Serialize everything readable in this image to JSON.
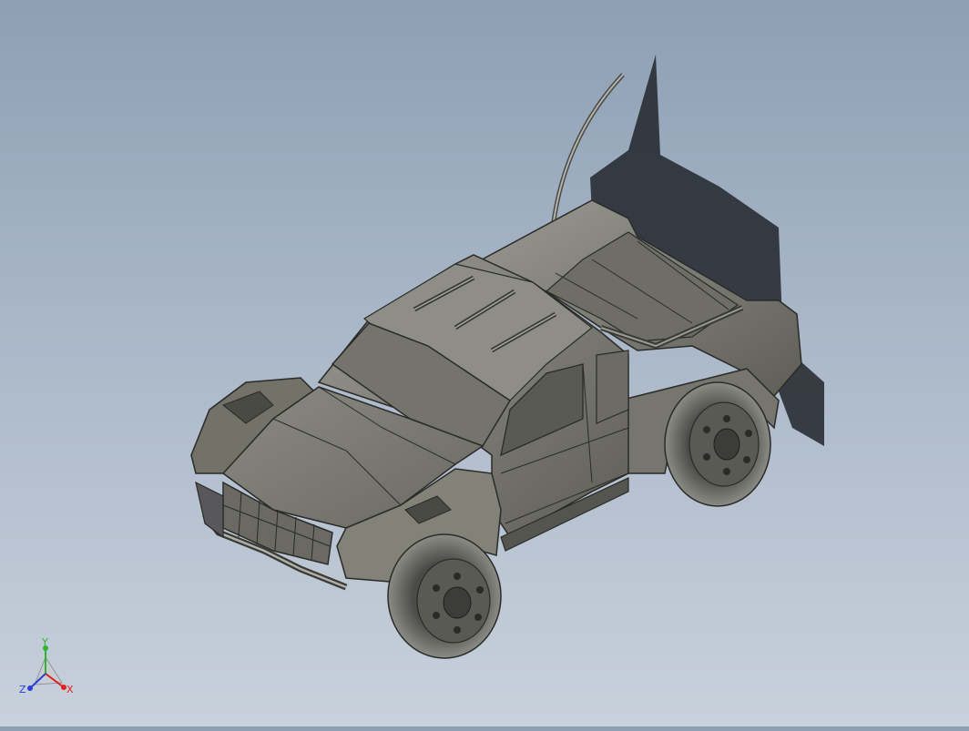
{
  "viewport": {
    "background_top": "#8e9fb4",
    "background_bottom": "#c8d1dc",
    "model_color": "#7f7f76",
    "model_edge_color": "#2a2a28",
    "shadow_color": "#22262c"
  },
  "triad": {
    "x_label": "X",
    "y_label": "Y",
    "z_label": "Z",
    "x_color": "#e0201c",
    "y_color": "#2fb52f",
    "z_color": "#2a3fd8"
  }
}
